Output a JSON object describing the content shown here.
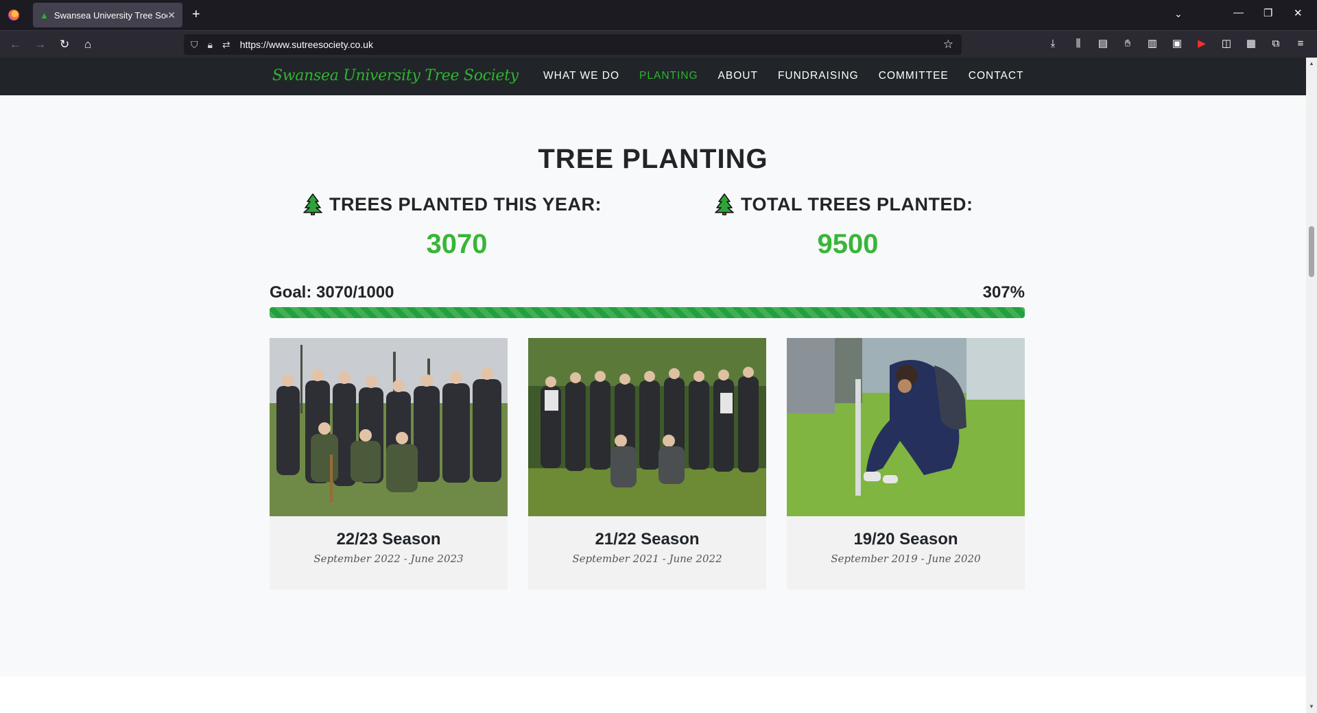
{
  "browser": {
    "tab_title": "Swansea University Tree Society",
    "url": "https://www.sutreesociety.co.uk"
  },
  "site": {
    "brand": "Swansea University Tree Society",
    "menu": [
      "WHAT WE DO",
      "PLANTING",
      "ABOUT",
      "FUNDRAISING",
      "COMMITTEE",
      "CONTACT"
    ],
    "active_menu": "PLANTING"
  },
  "planting": {
    "title": "TREE PLANTING",
    "this_year_label": "TREES PLANTED THIS YEAR:",
    "this_year_value": "3070",
    "total_label": "TOTAL TREES PLANTED:",
    "total_value": "9500",
    "goal_text": "Goal: 3070/1000",
    "goal_percent": "307%",
    "progress_fraction": 1.0
  },
  "seasons": [
    {
      "title": "22/23 Season",
      "dates": "September 2022 - June 2023"
    },
    {
      "title": "21/22 Season",
      "dates": "September 2021 - June 2022"
    },
    {
      "title": "19/20 Season",
      "dates": "September 2019 - June 2020"
    }
  ],
  "colors": {
    "accent_green": "#37b637",
    "nav_bg": "#212529",
    "progress_green": "#22a03c"
  }
}
